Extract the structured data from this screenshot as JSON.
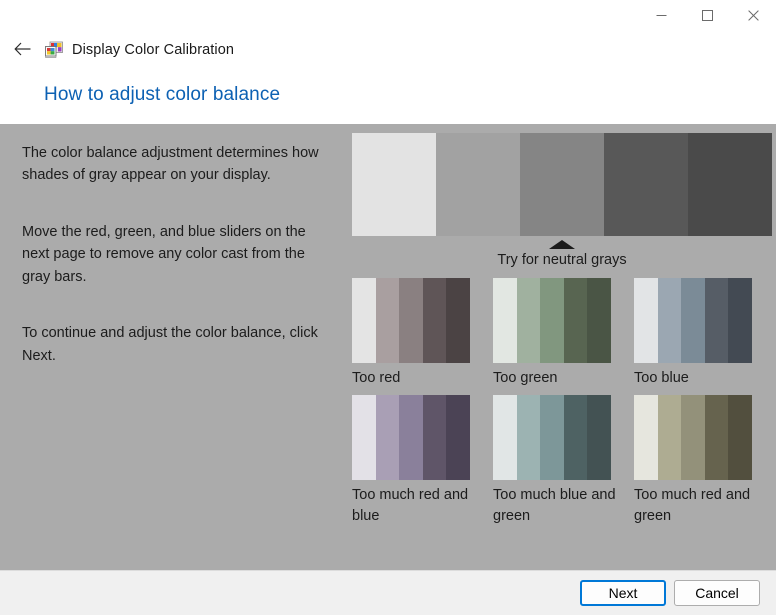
{
  "window": {
    "app_title": "Display Color Calibration",
    "app_icon": "display-color-calibration-icon",
    "back_icon": "back-arrow-icon",
    "controls": {
      "minimize": "minimize-icon",
      "maximize": "maximize-icon",
      "close": "close-icon"
    }
  },
  "page": {
    "heading": "How to adjust color balance",
    "paragraphs": [
      "The color balance adjustment determines how shades of gray appear on your display.",
      "Move the red, green, and blue sliders on the next page to remove any color cast from the gray bars.",
      "To continue and adjust the color balance, click Next."
    ]
  },
  "demo": {
    "gray_ramp": {
      "name": "neutral-gray-ramp",
      "colors": [
        "#e3e3e3",
        "#a2a2a2",
        "#858585",
        "#585858",
        "#4a4a4a"
      ]
    },
    "neutral_note": "Try for neutral grays",
    "arrow": "up-arrow-indicator",
    "samples": [
      {
        "label": "Too red",
        "colors": [
          "#e4e4e4",
          "#a99fa0",
          "#8a8081",
          "#5f5557",
          "#4b4344"
        ]
      },
      {
        "label": "Too green",
        "colors": [
          "#e2e7e2",
          "#a0b19f",
          "#81977f",
          "#586551",
          "#4a5545"
        ]
      },
      {
        "label": "Too blue",
        "colors": [
          "#e2e4e6",
          "#9ba7b2",
          "#7b8b97",
          "#565d66",
          "#434a53"
        ]
      },
      {
        "label": "Too much red and blue",
        "colors": [
          "#e3e1e7",
          "#a99fb5",
          "#8a809b",
          "#5f5568",
          "#4b4355"
        ]
      },
      {
        "label": "Too much blue and green",
        "colors": [
          "#e1e6e6",
          "#9cb3b2",
          "#7d9799",
          "#4e6263",
          "#435253"
        ]
      },
      {
        "label": "Too much red and green",
        "colors": [
          "#e6e6de",
          "#aeac92",
          "#93917a",
          "#66634e",
          "#524f3e"
        ]
      }
    ]
  },
  "footer": {
    "next_label": "Next",
    "cancel_label": "Cancel"
  },
  "theme": {
    "content_bg": "#ababab",
    "heading_color": "#0d61b3",
    "accent": "#0078d7",
    "footer_bg": "#f0f0f0"
  }
}
